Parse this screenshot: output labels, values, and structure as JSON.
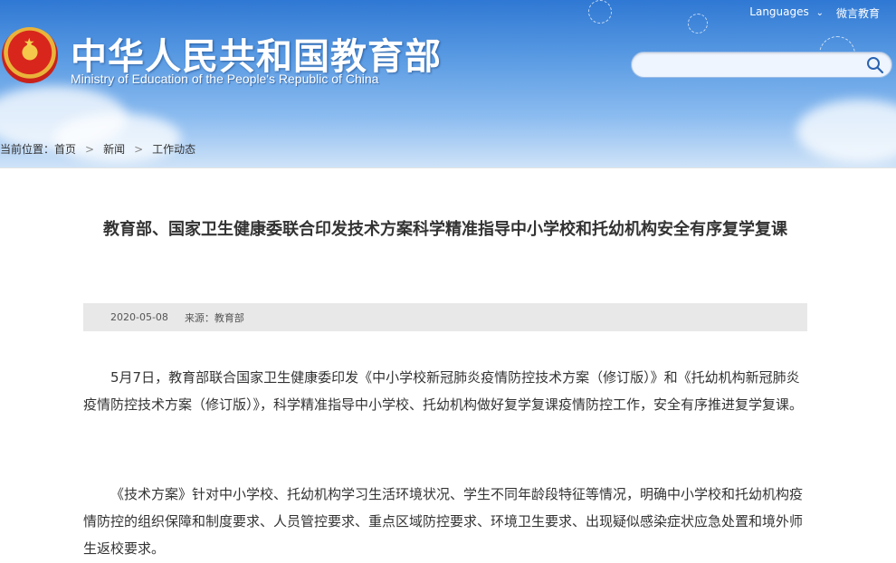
{
  "header": {
    "title_cn": "中华人民共和国教育部",
    "title_en": "Ministry of Education of the People's Republic of China",
    "languages_label": "Languages",
    "weibo_label": "微言教育",
    "search_placeholder": ""
  },
  "breadcrumb": {
    "prefix": "当前位置：",
    "items": [
      "首页",
      "新闻",
      "工作动态"
    ]
  },
  "article": {
    "title": "教育部、国家卫生健康委联合印发技术方案科学精准指导中小学校和托幼机构安全有序复学复课",
    "date": "2020-05-08",
    "source": "来源：教育部",
    "paragraphs": [
      "5月7日，教育部联合国家卫生健康委印发《中小学校新冠肺炎疫情防控技术方案（修订版）》和《托幼机构新冠肺炎疫情防控技术方案（修订版）》，科学精准指导中小学校、托幼机构做好复学复课疫情防控工作，安全有序推进复学复课。",
      "《技术方案》针对中小学校、托幼机构学习生活环境状况、学生不同年龄段特征等情况，明确中小学校和托幼机构疫情防控的组织保障和制度要求、人员管控要求、重点区域防控要求、环境卫生要求、出现疑似感染症状应急处置和境外师生返校要求。"
    ]
  },
  "icons": {
    "search": "search-icon",
    "emblem": "national-emblem-icon",
    "chevron": "chevron-down-icon"
  },
  "colors": {
    "header_blue": "#2f78d3",
    "meta_bg": "#e8e8e8"
  }
}
